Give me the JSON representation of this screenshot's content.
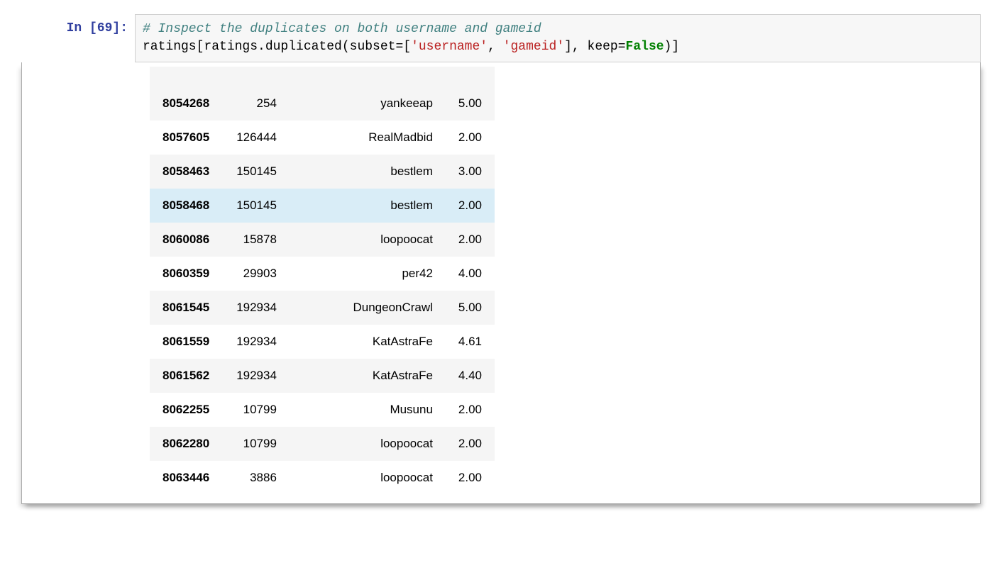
{
  "prompt": "In [69]:",
  "code": {
    "comment": "# Inspect the duplicates on both username and gameid",
    "line2_part1": "ratings[ratings.duplicated(subset=[",
    "line2_str1": "'username'",
    "line2_comma": ", ",
    "line2_str2": "'gameid'",
    "line2_part2": "], keep=",
    "line2_kw": "False",
    "line2_part3": ")]"
  },
  "table": {
    "rows": [
      {
        "index": "8054268",
        "gameid": "254",
        "username": "yankeeap",
        "rating": "5.00",
        "highlight": false
      },
      {
        "index": "8057605",
        "gameid": "126444",
        "username": "RealMadbid",
        "rating": "2.00",
        "highlight": false
      },
      {
        "index": "8058463",
        "gameid": "150145",
        "username": "bestlem",
        "rating": "3.00",
        "highlight": false
      },
      {
        "index": "8058468",
        "gameid": "150145",
        "username": "bestlem",
        "rating": "2.00",
        "highlight": true
      },
      {
        "index": "8060086",
        "gameid": "15878",
        "username": "loopoocat",
        "rating": "2.00",
        "highlight": false
      },
      {
        "index": "8060359",
        "gameid": "29903",
        "username": "per42",
        "rating": "4.00",
        "highlight": false
      },
      {
        "index": "8061545",
        "gameid": "192934",
        "username": "DungeonCrawl",
        "rating": "5.00",
        "highlight": false
      },
      {
        "index": "8061559",
        "gameid": "192934",
        "username": "KatAstraFe",
        "rating": "4.61",
        "highlight": false
      },
      {
        "index": "8061562",
        "gameid": "192934",
        "username": "KatAstraFe",
        "rating": "4.40",
        "highlight": false
      },
      {
        "index": "8062255",
        "gameid": "10799",
        "username": "Musunu",
        "rating": "2.00",
        "highlight": false
      },
      {
        "index": "8062280",
        "gameid": "10799",
        "username": "loopoocat",
        "rating": "2.00",
        "highlight": false
      },
      {
        "index": "8063446",
        "gameid": "3886",
        "username": "loopoocat",
        "rating": "2.00",
        "highlight": false
      }
    ]
  }
}
